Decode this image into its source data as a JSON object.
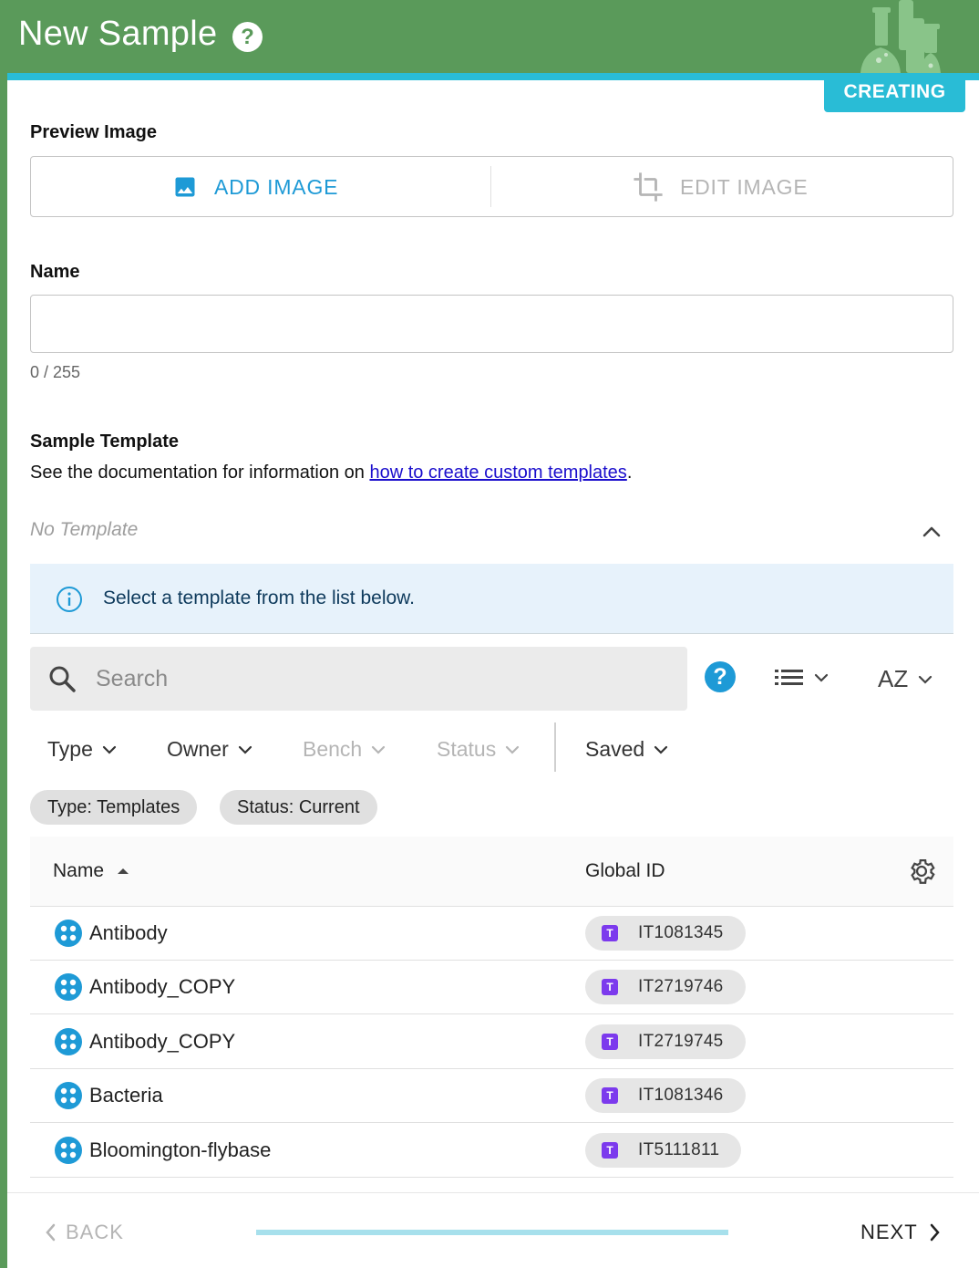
{
  "header": {
    "title": "New Sample",
    "help_glyph": "?",
    "status_badge": "CREATING",
    "colors": {
      "header_green": "#5a9a5a",
      "accent_cyan": "#29bcd6"
    }
  },
  "preview_image": {
    "label": "Preview Image",
    "add_label": "ADD IMAGE",
    "edit_label": "EDIT IMAGE",
    "add_icon": "image-icon",
    "edit_icon": "crop-icon"
  },
  "name_field": {
    "label": "Name",
    "value": "",
    "counter": "0 / 255"
  },
  "sample_template": {
    "label": "Sample Template",
    "doc_prefix": "See the documentation for information on ",
    "doc_link": "how to create custom templates",
    "doc_suffix": ".",
    "selected": "No Template",
    "info_message": "Select a template from the list below."
  },
  "toolbar": {
    "search_placeholder": "Search",
    "help_glyph": "?",
    "sort_label": "AZ",
    "filters": {
      "type": "Type",
      "owner": "Owner",
      "bench": "Bench",
      "status": "Status",
      "saved": "Saved"
    },
    "chips": [
      "Type: Templates",
      "Status: Current"
    ]
  },
  "table": {
    "columns": {
      "name": "Name",
      "global_id": "Global ID"
    },
    "sort_direction": "ascending",
    "rows": [
      {
        "name": "Antibody",
        "global_id": "IT1081345"
      },
      {
        "name": "Antibody_COPY",
        "global_id": "IT2719746"
      },
      {
        "name": "Antibody_COPY",
        "global_id": "IT2719745"
      },
      {
        "name": "Bacteria",
        "global_id": "IT1081346"
      },
      {
        "name": "Bloomington-flybase",
        "global_id": "IT5111811"
      }
    ],
    "gid_badge_letter": "T",
    "gid_badge_color": "#7c3aed",
    "row_icon_color": "#1e9ad6"
  },
  "footer": {
    "back_label": "BACK",
    "next_label": "NEXT"
  }
}
